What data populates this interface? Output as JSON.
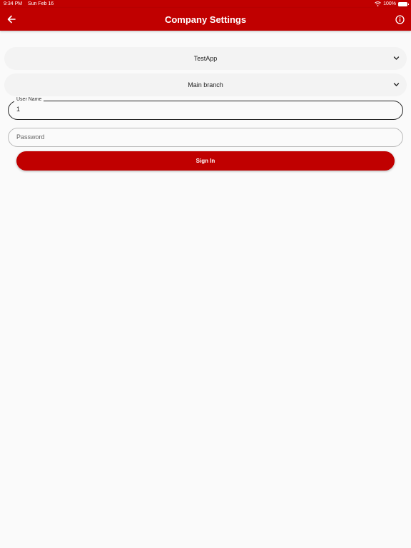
{
  "status_bar": {
    "time": "9:34 PM",
    "date": "Sun Feb 16",
    "battery": "100%"
  },
  "app_bar": {
    "title": "Company Settings",
    "back_icon": "arrow-back-icon",
    "info_icon": "info-circle-icon"
  },
  "company_select": {
    "value": "TestApp"
  },
  "branch_select": {
    "value": "Main branch"
  },
  "username": {
    "label": "User Name",
    "value": "1"
  },
  "password": {
    "placeholder": "Password",
    "value": ""
  },
  "sign_in": {
    "label": "Sign In"
  },
  "colors": {
    "primary": "#c00000",
    "background": "#fafafa"
  }
}
